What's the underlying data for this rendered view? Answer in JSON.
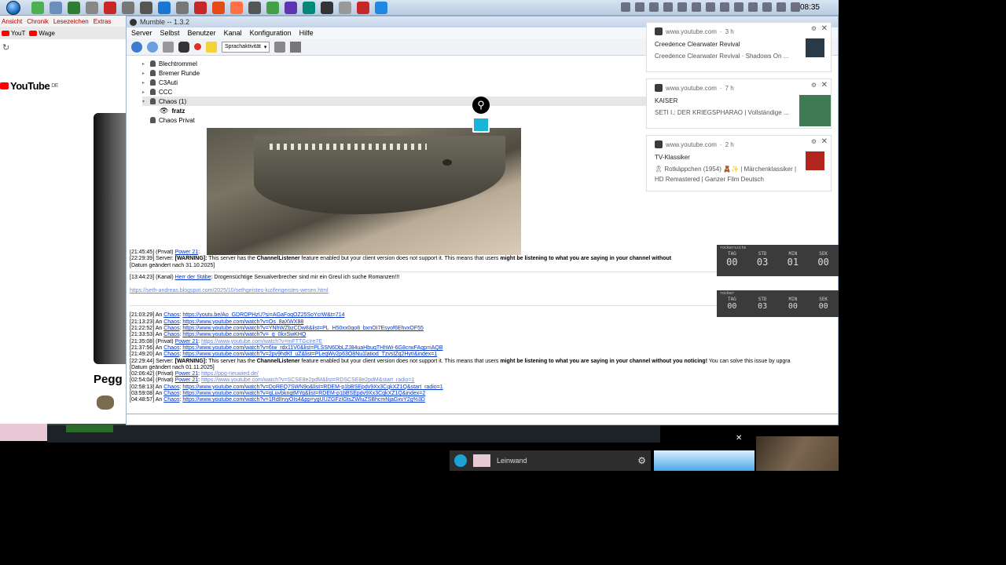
{
  "taskbar": {
    "clock": "08:35"
  },
  "browser": {
    "bookmarks": [
      "Ansicht",
      "Chronik",
      "Lesezeichen",
      "Extras"
    ],
    "tabs": [
      "YouT",
      "Wage"
    ],
    "yt_logo": "YouTube",
    "yt_region": "DE",
    "video_title": "Pegg"
  },
  "mumble": {
    "window_title": "Mumble -- 1.3.2",
    "menu": [
      "Server",
      "Selbst",
      "Benutzer",
      "Kanal",
      "Konfiguration",
      "Hilfe"
    ],
    "transmit_mode": "Sprachaktivität",
    "channels": [
      {
        "name": "Blechtrommel"
      },
      {
        "name": "Bremer Runde"
      },
      {
        "name": "C3Auti"
      },
      {
        "name": "CCC"
      },
      {
        "name": "Chaos (1)",
        "expanded": true
      },
      {
        "name": "fratz",
        "user": true
      },
      {
        "name": "Chaos Privat"
      }
    ],
    "log": {
      "l1_time": "[21:45:45] (Privat)",
      "l1_user": "Power 21",
      "l2_time": "[22:29:39] Server:",
      "l2_warn": "[WARNING]:",
      "l2_text1": " This server has the ",
      "l2_feat": "ChannelListener",
      "l2_text2": " feature enabled but your client version does not support it. This means that users ",
      "l2_bold": "might be listening to what you are saying in your channel without",
      "l3": "[Datum geändert nach 31.10.2025]",
      "l4_time": "[13:44:23] (Kanal)",
      "l4_user": "Herr der Stäbe",
      "l4_text": ": Drogensüchtige Sexualverbrecher sind mir ein Greul ich suche Romanzen!!!",
      "l5_link": "https://seth-andreas.blogspot.com/2025/10/sethgeistes-luziferigeistes-wesen.html",
      "l6_time": "[21:03:29] An",
      "l6_user": "Chaos",
      "l6_link": "https://youtu.be/Ao_GDROPHzU?si=AGaFoqOZ25SoYcrW&t=714",
      "l7_time": "[21:13:23] An",
      "l7_user": "Chaos",
      "l7_link": "https://www.youtube.com/watch?v=Os_8aXWX88",
      "l8_time": "[21:22:52] An",
      "l8_user": "Chaos",
      "l8_link": "https://www.youtube.com/watch?v=YNhWZbzCDw8&list=PL_H50xx0qo8_bxnOI7Esyof6EhvxOF55",
      "l9_time": "[21:33:53] An",
      "l9_user": "Chaos",
      "l9_link": "https://www.youtube.com/watch?v=_q_0kxSwKHQ",
      "l10_time": "[21:35:08] (Privat)",
      "l10_user": "Power 21",
      "l10_link": "https://www.youtube.com/watch?v=mFTTGcIre7E",
      "l11_time": "[21:37:56] An",
      "l11_user": "Chaos",
      "l11_link": "https://www.youtube.com/watch?v=6iw_rdx11V0&list=PLSSN6DbLZJ84uaHbuqTHhWi-6G8crwFAqp=iAQB",
      "l12_time": "[21:49:20] An",
      "l12_user": "Chaos",
      "l12_link": "https://www.youtube.com/watch?v=2pv9hdKf_uZ&list=PLeqWv2p63O8Nu1latiod_TzvsIZq2HytI&index=1",
      "l13_time": "[22:29:44] Server:",
      "l13_warn": "[WARNING]:",
      "l13_text1": " This server has the ",
      "l13_feat": "ChannelListener",
      "l13_text2": " feature enabled but your client version does not support it. This means that users ",
      "l13_bold": "might be listening to what you are saying in your channel without you noticing!",
      "l13_text3": " You can solve this issue by upgra",
      "l14": "[Datum geändert nach 01.11.2025]",
      "l15_time": "[02:06:42] (Privat)",
      "l15_user": "Power 21",
      "l15_link": "https://ppg-neuwied.de/",
      "l16_time": "[02:54:04] (Privat)",
      "l16_user": "Power 21",
      "l16_link": "https://www.youtube.com/watch?v=SCSE8e2pdM&list=RDSCSE8e2pdM&start_radio=1",
      "l17_time": "[02:58:13] An",
      "l17_user": "Chaos",
      "l17_link": "https://www.youtube.com/watch?v=DoREQ7SWN9o&list=RDEM-p1bBSEpdv9Xx3CqkXZ1Q&start_radio=1",
      "l18_time": "[03:59:08] An",
      "l18_user": "Chaos",
      "l18_link": "https://www.youtube.com/watch?v=qLuvbkngtMYq&list=RDEM-p1bBSEpdv9Xx3CqkXZ1Q&index=2",
      "l19_time": "[04:48:57] An",
      "l19_user": "Chaos",
      "l19_link": "https://www.youtube.com/watch?v=1RdIIrvyOIs4&pp=ygUUZGFzIGtsZWluZSBhcmNjaGxvY2g%3D"
    }
  },
  "notifications": [
    {
      "source": "www.youtube.com",
      "age": "3 h",
      "title": "Creedence Clearwater Revival",
      "body": "Creedence Clearwater Revival · Shadows On ..."
    },
    {
      "source": "www.youtube.com",
      "age": "7 h",
      "title": "KAISER",
      "body": "SETI I.: DER KRIEGSPHARAO | Vollständige ..."
    },
    {
      "source": "www.youtube.com",
      "age": "2 h",
      "title": "TV-Klassiker",
      "body": "🎗 Rotkäppchen (1954) 🧸✨ | Märchenklassiker | HD Remastered | Ganzer Film Deutsch"
    }
  ],
  "timer1": {
    "brand": "rockerssite",
    "labels": [
      "TAG",
      "STD",
      "MIN",
      "SEK"
    ],
    "values": [
      "00",
      "03",
      "01",
      "00"
    ]
  },
  "timer2": {
    "brand": "rocker",
    "labels": [
      "TAG",
      "STD",
      "MIN",
      "SEK"
    ],
    "values": [
      "00",
      "03",
      "00",
      "00"
    ]
  },
  "bottom": {
    "leinwand": "Leinwand"
  }
}
